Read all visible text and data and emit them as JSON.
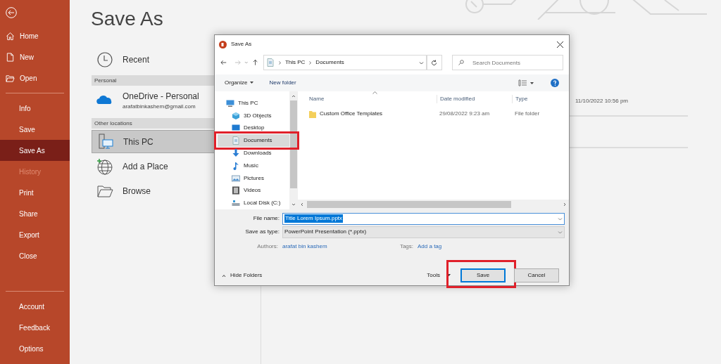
{
  "sidebar": {
    "groups": [
      [
        {
          "label": "Home",
          "selected": false,
          "disabled": false
        },
        {
          "label": "New",
          "selected": false,
          "disabled": false
        },
        {
          "label": "Open",
          "selected": false,
          "disabled": false
        }
      ],
      [
        {
          "label": "Info",
          "selected": false,
          "disabled": false
        },
        {
          "label": "Save",
          "selected": false,
          "disabled": false
        },
        {
          "label": "Save As",
          "selected": true,
          "disabled": false
        },
        {
          "label": "History",
          "selected": false,
          "disabled": true
        },
        {
          "label": "Print",
          "selected": false,
          "disabled": false
        },
        {
          "label": "Share",
          "selected": false,
          "disabled": false
        },
        {
          "label": "Export",
          "selected": false,
          "disabled": false
        },
        {
          "label": "Close",
          "selected": false,
          "disabled": false
        }
      ],
      [
        {
          "label": "Account",
          "selected": false,
          "disabled": false
        },
        {
          "label": "Feedback",
          "selected": false,
          "disabled": false
        },
        {
          "label": "Options",
          "selected": false,
          "disabled": false
        }
      ]
    ]
  },
  "page_title": "Save As",
  "locations": [
    {
      "kind": "recent",
      "label": "Recent",
      "selected": false
    },
    {
      "kind": "heading",
      "label": "Personal"
    },
    {
      "kind": "onedrive",
      "label": "OneDrive - Personal",
      "detail": "arafatbinkashem@gmail.com",
      "selected": false
    },
    {
      "kind": "heading",
      "label": "Other locations"
    },
    {
      "kind": "pc",
      "label": "This PC",
      "selected": true
    },
    {
      "kind": "add",
      "label": "Add a Place",
      "selected": false
    },
    {
      "kind": "browse",
      "label": "Browse",
      "selected": false
    }
  ],
  "recent_date": "11/10/2022 10:56 pm",
  "dialog": {
    "title": "Save As",
    "address": [
      "This PC",
      "Documents"
    ],
    "search_placeholder": "Search Documents",
    "organize": "Organize",
    "new_folder": "New folder",
    "nav_items": [
      {
        "kind": "pc",
        "label": "This PC",
        "selected": false
      },
      {
        "kind": "cube",
        "label": "3D Objects",
        "selected": false
      },
      {
        "kind": "desktop",
        "label": "Desktop",
        "selected": false
      },
      {
        "kind": "documents",
        "label": "Documents",
        "selected": true,
        "highlighted": true
      },
      {
        "kind": "downloads",
        "label": "Downloads",
        "selected": false
      },
      {
        "kind": "music",
        "label": "Music",
        "selected": false
      },
      {
        "kind": "pictures",
        "label": "Pictures",
        "selected": false
      },
      {
        "kind": "videos",
        "label": "Videos",
        "selected": false
      },
      {
        "kind": "disk",
        "label": "Local Disk (C:)",
        "selected": false
      }
    ],
    "columns": [
      "Name",
      "Date modified",
      "Type"
    ],
    "rows": [
      {
        "name": "Custom Office Templates",
        "date": "29/08/2022 9:23 am",
        "type": "File folder"
      }
    ],
    "file_name_label": "File name:",
    "file_name": "Title Lorem Ipsum.pptx",
    "type_label": "Save as type:",
    "type_value": "PowerPoint Presentation (*.pptx)",
    "authors_label": "Authors:",
    "authors": "arafat bin kashem",
    "tags_label": "Tags:",
    "tags": "Add a tag",
    "hide_folders": "Hide Folders",
    "tools": "Tools",
    "buttons": [
      {
        "kind": "save",
        "label": "Save",
        "highlighted": true
      },
      {
        "kind": "cancel",
        "label": "Cancel"
      }
    ]
  }
}
